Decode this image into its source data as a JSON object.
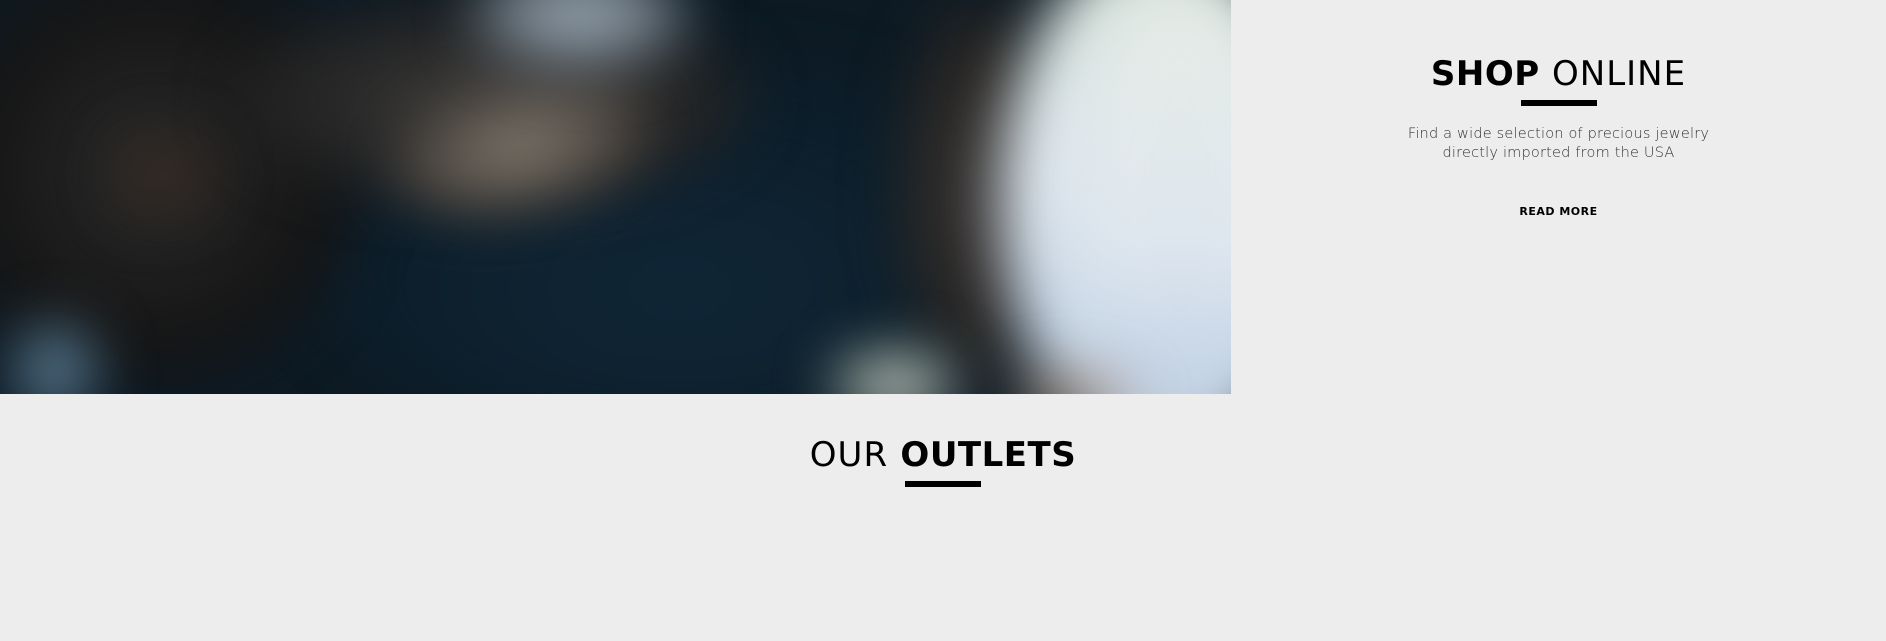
{
  "hero": {
    "image_alt": ""
  },
  "shop_online": {
    "heading_bold": "SHOP",
    "heading_light": "ONLINE",
    "description_line1": "Find a wide selection of precious jewelry",
    "description_line2": "directly imported from the USA",
    "read_more_label": "READ MORE"
  },
  "outlets": {
    "heading_light": "OUR",
    "heading_bold": "OUTLETS"
  },
  "colors": {
    "background": "#ededed",
    "text": "#000000",
    "accent_bar": "#000000"
  }
}
